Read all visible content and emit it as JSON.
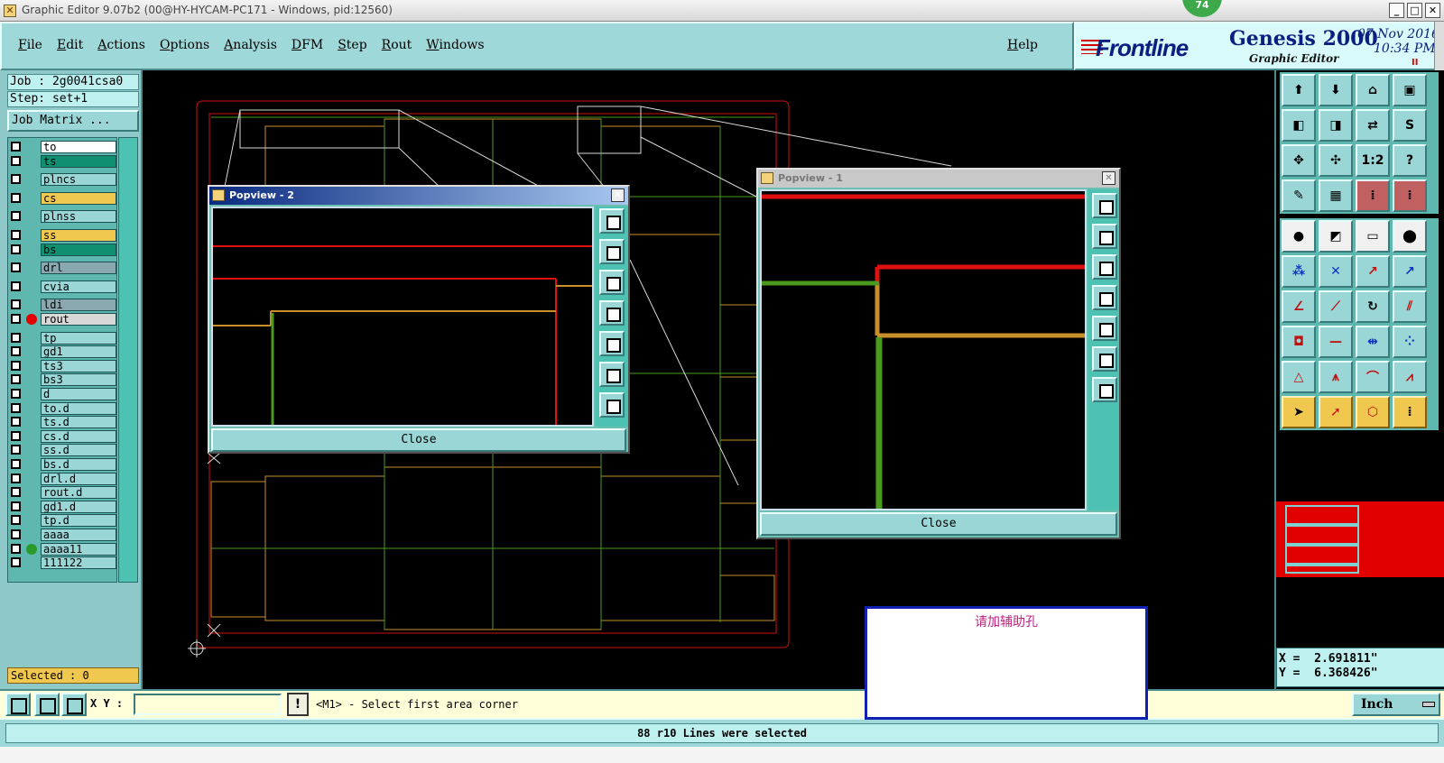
{
  "window": {
    "title": "Graphic Editor 9.07b2 (00@HY-HYCAM-PC171 - Windows, pid:12560)",
    "badge": "74",
    "min": "_",
    "max": "□",
    "close": "✕"
  },
  "menu": {
    "items": [
      "File",
      "Edit",
      "Actions",
      "Options",
      "Analysis",
      "DFM",
      "Step",
      "Rout",
      "Windows"
    ],
    "help": "Help"
  },
  "brand": {
    "logo": "Frontline",
    "product": "Genesis 2000",
    "subtitle": "Graphic Editor",
    "date": "07 Nov 2016",
    "time": "10:34 PM",
    "pause": "II"
  },
  "job": {
    "job_line": "Job : 2g0041csa0",
    "step_line": "Step: set+1",
    "matrix_button": "Job Matrix ..."
  },
  "layers": [
    {
      "name": "to",
      "color": "#ffffff",
      "dot": ""
    },
    {
      "name": "ts",
      "color": "#109070",
      "dot": ""
    },
    {
      "name": "plncs",
      "color": "#9ad6d6",
      "dot": ""
    },
    {
      "name": "cs",
      "color": "#f0c850",
      "dot": ""
    },
    {
      "name": "plnss",
      "color": "#9ad6d6",
      "dot": ""
    },
    {
      "name": "ss",
      "color": "#f0c850",
      "dot": ""
    },
    {
      "name": "bs",
      "color": "#109070",
      "dot": ""
    },
    {
      "name": "drl",
      "color": "#8aa8b0",
      "dot": ""
    },
    {
      "name": "cvia",
      "color": "#9ad6d6",
      "dot": ""
    },
    {
      "name": "ldi",
      "color": "#8aa8b0",
      "dot": ""
    },
    {
      "name": "rout",
      "color": "#d8d8d8",
      "dot": "#e00000"
    },
    {
      "name": "tp",
      "color": "#9ad6d6",
      "dot": ""
    },
    {
      "name": "gd1",
      "color": "#9ad6d6",
      "dot": ""
    },
    {
      "name": "ts3",
      "color": "#9ad6d6",
      "dot": ""
    },
    {
      "name": "bs3",
      "color": "#9ad6d6",
      "dot": ""
    },
    {
      "name": "d",
      "color": "#9ad6d6",
      "dot": ""
    },
    {
      "name": "to.d",
      "color": "#9ad6d6",
      "dot": ""
    },
    {
      "name": "ts.d",
      "color": "#9ad6d6",
      "dot": ""
    },
    {
      "name": "cs.d",
      "color": "#9ad6d6",
      "dot": ""
    },
    {
      "name": "ss.d",
      "color": "#9ad6d6",
      "dot": ""
    },
    {
      "name": "bs.d",
      "color": "#9ad6d6",
      "dot": ""
    },
    {
      "name": "drl.d",
      "color": "#9ad6d6",
      "dot": ""
    },
    {
      "name": "rout.d",
      "color": "#9ad6d6",
      "dot": ""
    },
    {
      "name": "gd1.d",
      "color": "#9ad6d6",
      "dot": ""
    },
    {
      "name": "tp.d",
      "color": "#9ad6d6",
      "dot": ""
    },
    {
      "name": "aaaa",
      "color": "#9ad6d6",
      "dot": ""
    },
    {
      "name": "aaaa11",
      "color": "#9ad6d6",
      "dot": "#2a9a2a"
    },
    {
      "name": "111122",
      "color": "#9ad6d6",
      "dot": ""
    }
  ],
  "selected": "Selected : 0",
  "popup2": {
    "title": "Popview - 2",
    "close_label": "Close",
    "x": "✕"
  },
  "popup1": {
    "title": "Popview - 1",
    "close_label": "Close",
    "x": "✕"
  },
  "tools": {
    "row3": [
      "1:2",
      "?"
    ]
  },
  "coords": {
    "x": "X =  2.691811\"",
    "y": "Y =  6.368426\""
  },
  "command": {
    "xy_label": "X Y :",
    "xy_value": "",
    "warn": "!",
    "prompt": "<M1> - Select first area corner",
    "units": "Inch"
  },
  "status": "88 r10 Lines were selected",
  "note": "请加辅助孔"
}
